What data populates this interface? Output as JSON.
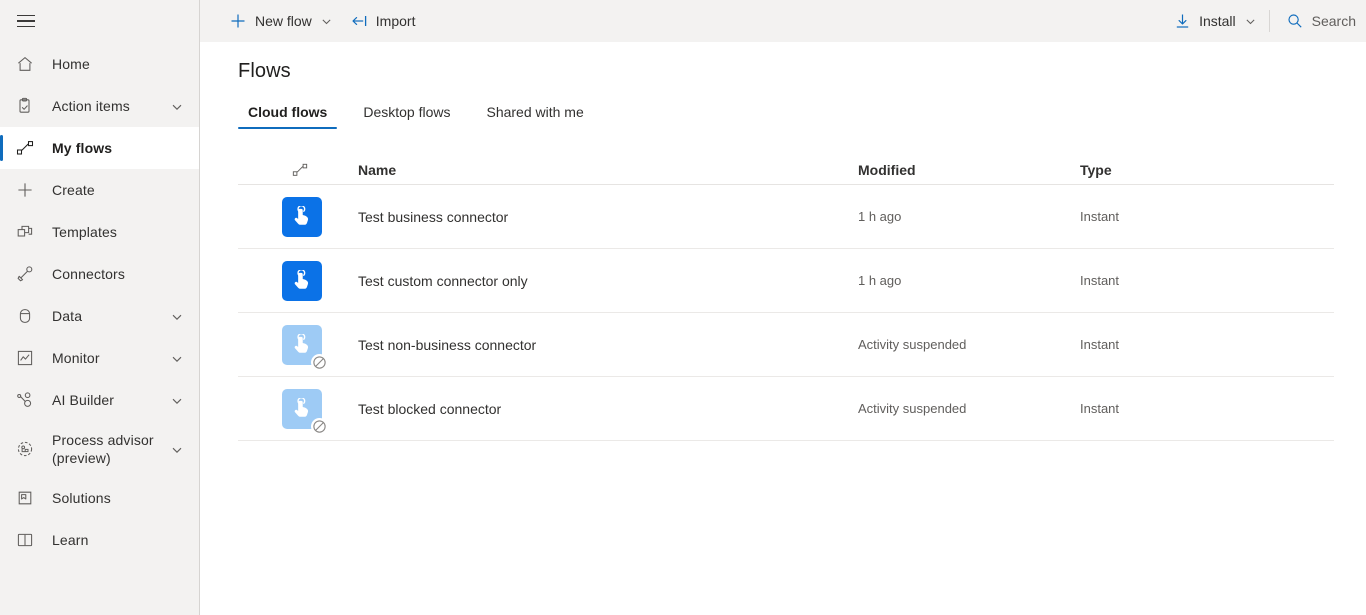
{
  "sidebar": {
    "menu_icon": "hamburger-icon",
    "items": [
      {
        "label": "Home",
        "icon": "home-icon",
        "expandable": false,
        "selected": false
      },
      {
        "label": "Action items",
        "icon": "clipboard-check-icon",
        "expandable": true,
        "selected": false
      },
      {
        "label": "My flows",
        "icon": "flow-icon",
        "expandable": false,
        "selected": true
      },
      {
        "label": "Create",
        "icon": "plus-icon",
        "expandable": false,
        "selected": false
      },
      {
        "label": "Templates",
        "icon": "templates-icon",
        "expandable": false,
        "selected": false
      },
      {
        "label": "Connectors",
        "icon": "plug-icon",
        "expandable": false,
        "selected": false
      },
      {
        "label": "Data",
        "icon": "database-icon",
        "expandable": true,
        "selected": false
      },
      {
        "label": "Monitor",
        "icon": "monitor-chart-icon",
        "expandable": true,
        "selected": false
      },
      {
        "label": "AI Builder",
        "icon": "ai-builder-icon",
        "expandable": true,
        "selected": false
      },
      {
        "label": "Process advisor (preview)",
        "icon": "process-advisor-icon",
        "expandable": true,
        "selected": false
      },
      {
        "label": "Solutions",
        "icon": "solutions-icon",
        "expandable": false,
        "selected": false
      },
      {
        "label": "Learn",
        "icon": "book-icon",
        "expandable": false,
        "selected": false
      }
    ]
  },
  "commandbar": {
    "new_flow": {
      "label": "New flow",
      "icon": "plus-icon",
      "has_caret": true
    },
    "import": {
      "label": "Import",
      "icon": "import-arrow-icon"
    },
    "install": {
      "label": "Install",
      "icon": "download-icon",
      "has_caret": true
    },
    "search": {
      "label": "Search",
      "icon": "search-icon"
    }
  },
  "page": {
    "title": "Flows",
    "tabs": [
      {
        "label": "Cloud flows",
        "active": true
      },
      {
        "label": "Desktop flows",
        "active": false
      },
      {
        "label": "Shared with me",
        "active": false
      }
    ]
  },
  "table": {
    "headers": {
      "icon": "flow-icon",
      "name": "Name",
      "modified": "Modified",
      "type": "Type"
    },
    "rows": [
      {
        "name": "Test business connector",
        "modified": "1 h ago",
        "type": "Instant",
        "icon": "instant-flow-icon",
        "disabled": false
      },
      {
        "name": "Test custom connector only",
        "modified": "1 h ago",
        "type": "Instant",
        "icon": "instant-flow-icon",
        "disabled": false
      },
      {
        "name": "Test non-business connector",
        "modified": "Activity suspended",
        "type": "Instant",
        "icon": "instant-flow-icon",
        "disabled": true
      },
      {
        "name": "Test blocked connector",
        "modified": "Activity suspended",
        "type": "Instant",
        "icon": "instant-flow-icon",
        "disabled": true
      }
    ]
  },
  "colors": {
    "accent": "#0f6cbd",
    "tile": "#0b72e7",
    "tile_disabled": "#9ecbf5",
    "chrome": "#f3f2f1",
    "text": "#323130"
  }
}
